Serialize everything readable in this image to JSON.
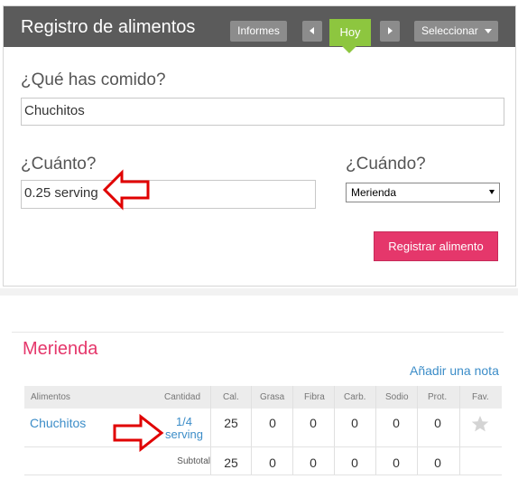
{
  "header": {
    "title": "Registro de alimentos",
    "reports_label": "Informes",
    "today_label": "Hoy",
    "select_label": "Seleccionar"
  },
  "form": {
    "food_question": "¿Qué has comido?",
    "food_value": "Chuchitos",
    "qty_question": "¿Cuánto?",
    "qty_value": "0.25 serving",
    "when_question": "¿Cuándo?",
    "when_selected": "Merienda",
    "submit_label": "Registrar alimento"
  },
  "meal": {
    "title": "Merienda",
    "add_note": "Añadir una nota",
    "columns": [
      "Alimentos",
      "Cantidad",
      "Cal.",
      "Grasa",
      "Fibra",
      "Carb.",
      "Sodio",
      "Prot.",
      "Fav."
    ],
    "row": {
      "food": "Chuchitos",
      "qty_line1": "1/4",
      "qty_line2": "serving",
      "values": [
        "25",
        "0",
        "0",
        "0",
        "0",
        "0"
      ]
    },
    "subtotal": {
      "label": "Subtotal",
      "values": [
        "25",
        "0",
        "0",
        "0",
        "0",
        "0"
      ]
    }
  },
  "colors": {
    "header_bg": "#5b5b5b",
    "accent_green": "#8dc63f",
    "accent_pink": "#e5376b",
    "link_blue": "#3c8dc8",
    "annotation_red": "#e00000"
  },
  "icons": [
    "chevron-left-icon",
    "chevron-right-icon",
    "caret-down-icon",
    "star-icon",
    "red-arrow-annotation"
  ]
}
